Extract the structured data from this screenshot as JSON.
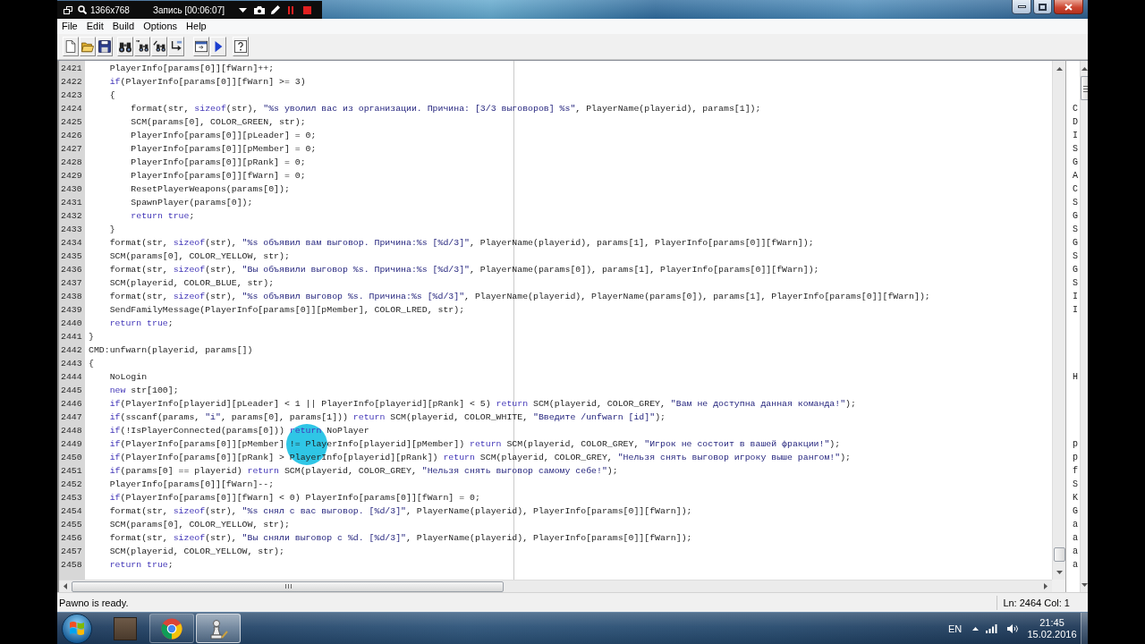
{
  "recorder": {
    "resolution": "1366x768",
    "status": "Запись [00:06:07]"
  },
  "menu": [
    "File",
    "Edit",
    "Build",
    "Options",
    "Help"
  ],
  "editor": {
    "lines": [
      {
        "number": "2421",
        "tokens": [
          {
            "kind": "plain",
            "text": "    PlayerInfo[params[0]][fWarn]++;"
          }
        ]
      },
      {
        "number": "2422",
        "tokens": [
          {
            "kind": "keyword",
            "text": "    if"
          },
          {
            "kind": "plain",
            "text": "(PlayerInfo[params[0]][fWarn] >= 3)"
          }
        ]
      },
      {
        "number": "2423",
        "tokens": [
          {
            "kind": "plain",
            "text": "    {"
          }
        ]
      },
      {
        "number": "2424",
        "tokens": [
          {
            "kind": "plain",
            "text": "        format(str, "
          },
          {
            "kind": "keyword",
            "text": "sizeof"
          },
          {
            "kind": "plain",
            "text": "(str), "
          },
          {
            "kind": "string",
            "text": "\"%s уволил вас из организации. Причина: [3/3 выговоров] %s\""
          },
          {
            "kind": "plain",
            "text": ", PlayerName(playerid), params[1]);"
          }
        ]
      },
      {
        "number": "2425",
        "tokens": [
          {
            "kind": "plain",
            "text": "        SCM(params[0], COLOR_GREEN, str);"
          }
        ]
      },
      {
        "number": "2426",
        "tokens": [
          {
            "kind": "plain",
            "text": "        PlayerInfo[params[0]][pLeader] = 0;"
          }
        ]
      },
      {
        "number": "2427",
        "tokens": [
          {
            "kind": "plain",
            "text": "        PlayerInfo[params[0]][pMember] = 0;"
          }
        ]
      },
      {
        "number": "2428",
        "tokens": [
          {
            "kind": "plain",
            "text": "        PlayerInfo[params[0]][pRank] = 0;"
          }
        ]
      },
      {
        "number": "2429",
        "tokens": [
          {
            "kind": "plain",
            "text": "        PlayerInfo[params[0]][fWarn] = 0;"
          }
        ]
      },
      {
        "number": "2430",
        "tokens": [
          {
            "kind": "plain",
            "text": "        ResetPlayerWeapons(params[0]);"
          }
        ]
      },
      {
        "number": "2431",
        "tokens": [
          {
            "kind": "plain",
            "text": "        SpawnPlayer(params[0]);"
          }
        ]
      },
      {
        "number": "2432",
        "tokens": [
          {
            "kind": "keyword",
            "text": "        return"
          },
          {
            "kind": "keyword",
            "text": " true"
          },
          {
            "kind": "plain",
            "text": ";"
          }
        ]
      },
      {
        "number": "2433",
        "tokens": [
          {
            "kind": "plain",
            "text": "    }"
          }
        ]
      },
      {
        "number": "2434",
        "tokens": [
          {
            "kind": "plain",
            "text": "    format(str, "
          },
          {
            "kind": "keyword",
            "text": "sizeof"
          },
          {
            "kind": "plain",
            "text": "(str), "
          },
          {
            "kind": "string",
            "text": "\"%s объявил вам выговор. Причина:%s [%d/3]\""
          },
          {
            "kind": "plain",
            "text": ", PlayerName(playerid), params[1], PlayerInfo[params[0]][fWarn]);"
          }
        ]
      },
      {
        "number": "2435",
        "tokens": [
          {
            "kind": "plain",
            "text": "    SCM(params[0], COLOR_YELLOW, str);"
          }
        ]
      },
      {
        "number": "2436",
        "tokens": [
          {
            "kind": "plain",
            "text": "    format(str, "
          },
          {
            "kind": "keyword",
            "text": "sizeof"
          },
          {
            "kind": "plain",
            "text": "(str), "
          },
          {
            "kind": "string",
            "text": "\"Вы объявили выговор %s. Причина:%s [%d/3]\""
          },
          {
            "kind": "plain",
            "text": ", PlayerName(params[0]), params[1], PlayerInfo[params[0]][fWarn]);"
          }
        ]
      },
      {
        "number": "2437",
        "tokens": [
          {
            "kind": "plain",
            "text": "    SCM(playerid, COLOR_BLUE, str);"
          }
        ]
      },
      {
        "number": "2438",
        "tokens": [
          {
            "kind": "plain",
            "text": "    format(str, "
          },
          {
            "kind": "keyword",
            "text": "sizeof"
          },
          {
            "kind": "plain",
            "text": "(str), "
          },
          {
            "kind": "string",
            "text": "\"%s объявил выговор %s. Причина:%s [%d/3]\""
          },
          {
            "kind": "plain",
            "text": ", PlayerName(playerid), PlayerName(params[0]), params[1], PlayerInfo[params[0]][fWarn]);"
          }
        ]
      },
      {
        "number": "2439",
        "tokens": [
          {
            "kind": "plain",
            "text": "    SendFamilyMessage(PlayerInfo[params[0]][pMember], COLOR_LRED, str);"
          }
        ]
      },
      {
        "number": "2440",
        "tokens": [
          {
            "kind": "keyword",
            "text": "    return"
          },
          {
            "kind": "keyword",
            "text": " true"
          },
          {
            "kind": "plain",
            "text": ";"
          }
        ]
      },
      {
        "number": "2441",
        "tokens": [
          {
            "kind": "plain",
            "text": "}"
          }
        ]
      },
      {
        "number": "2442",
        "tokens": [
          {
            "kind": "plain",
            "text": "CMD:unfwarn(playerid, params[])"
          }
        ]
      },
      {
        "number": "2443",
        "tokens": [
          {
            "kind": "plain",
            "text": "{"
          }
        ]
      },
      {
        "number": "2444",
        "tokens": [
          {
            "kind": "plain",
            "text": "    NoLogin"
          }
        ]
      },
      {
        "number": "2445",
        "tokens": [
          {
            "kind": "keyword",
            "text": "    new"
          },
          {
            "kind": "plain",
            "text": " str[100];"
          }
        ]
      },
      {
        "number": "2446",
        "tokens": [
          {
            "kind": "keyword",
            "text": "    if"
          },
          {
            "kind": "plain",
            "text": "(PlayerInfo[playerid][pLeader] < 1 || PlayerInfo[playerid][pRank] < 5) "
          },
          {
            "kind": "keyword",
            "text": "return"
          },
          {
            "kind": "plain",
            "text": " SCM(playerid, COLOR_GREY, "
          },
          {
            "kind": "string",
            "text": "\"Вам не доступна данная команда!\""
          },
          {
            "kind": "plain",
            "text": ");"
          }
        ]
      },
      {
        "number": "2447",
        "tokens": [
          {
            "kind": "keyword",
            "text": "    if"
          },
          {
            "kind": "plain",
            "text": "(sscanf(params, "
          },
          {
            "kind": "string",
            "text": "\"i\""
          },
          {
            "kind": "plain",
            "text": ", params[0], params[1])) "
          },
          {
            "kind": "keyword",
            "text": "return"
          },
          {
            "kind": "plain",
            "text": " SCM(playerid, COLOR_WHITE, "
          },
          {
            "kind": "string",
            "text": "\"Введите /unfwarn [id]\""
          },
          {
            "kind": "plain",
            "text": ");"
          }
        ]
      },
      {
        "number": "2448",
        "tokens": [
          {
            "kind": "keyword",
            "text": "    if"
          },
          {
            "kind": "plain",
            "text": "(!IsPlayerConnected(params[0])) "
          },
          {
            "kind": "keyword",
            "text": "return"
          },
          {
            "kind": "plain",
            "text": " NoPlayer"
          }
        ]
      },
      {
        "number": "2449",
        "tokens": [
          {
            "kind": "keyword",
            "text": "    if"
          },
          {
            "kind": "plain",
            "text": "(PlayerInfo[params[0]][pMember] != PlayerInfo[playerid][pMember]) "
          },
          {
            "kind": "keyword",
            "text": "return"
          },
          {
            "kind": "plain",
            "text": " SCM(playerid, COLOR_GREY, "
          },
          {
            "kind": "string",
            "text": "\"Игрок не состоит в вашей фракции!\""
          },
          {
            "kind": "plain",
            "text": ");"
          }
        ]
      },
      {
        "number": "2450",
        "tokens": [
          {
            "kind": "keyword",
            "text": "    if"
          },
          {
            "kind": "plain",
            "text": "(PlayerInfo[params[0]][pRank] > PlayerInfo[playerid][pRank]) "
          },
          {
            "kind": "keyword",
            "text": "return"
          },
          {
            "kind": "plain",
            "text": " SCM(playerid, COLOR_GREY, "
          },
          {
            "kind": "string",
            "text": "\"Нельзя снять выговор игроку выше рангом!\""
          },
          {
            "kind": "plain",
            "text": ");"
          }
        ]
      },
      {
        "number": "2451",
        "tokens": [
          {
            "kind": "keyword",
            "text": "    if"
          },
          {
            "kind": "plain",
            "text": "(params[0] == playerid) "
          },
          {
            "kind": "keyword",
            "text": "return"
          },
          {
            "kind": "plain",
            "text": " SCM(playerid, COLOR_GREY, "
          },
          {
            "kind": "string",
            "text": "\"Нельзя снять выговор самому себе!\""
          },
          {
            "kind": "plain",
            "text": ");"
          }
        ]
      },
      {
        "number": "2452",
        "tokens": [
          {
            "kind": "plain",
            "text": "    PlayerInfo[params[0]][fWarn]--;"
          }
        ]
      },
      {
        "number": "2453",
        "tokens": [
          {
            "kind": "keyword",
            "text": "    if"
          },
          {
            "kind": "plain",
            "text": "(PlayerInfo[params[0]][fWarn] < 0) PlayerInfo[params[0]][fWarn] = 0;"
          }
        ]
      },
      {
        "number": "2454",
        "tokens": [
          {
            "kind": "plain",
            "text": "    format(str, "
          },
          {
            "kind": "keyword",
            "text": "sizeof"
          },
          {
            "kind": "plain",
            "text": "(str), "
          },
          {
            "kind": "string",
            "text": "\"%s снял с вас выговор. [%d/3]\""
          },
          {
            "kind": "plain",
            "text": ", PlayerName(playerid), PlayerInfo[params[0]][fWarn]);"
          }
        ]
      },
      {
        "number": "2455",
        "tokens": [
          {
            "kind": "plain",
            "text": "    SCM(params[0], COLOR_YELLOW, str);"
          }
        ]
      },
      {
        "number": "2456",
        "tokens": [
          {
            "kind": "plain",
            "text": "    format(str, "
          },
          {
            "kind": "keyword",
            "text": "sizeof"
          },
          {
            "kind": "plain",
            "text": "(str), "
          },
          {
            "kind": "string",
            "text": "\"Вы сняли выговор с %d. [%d/3]\""
          },
          {
            "kind": "plain",
            "text": ", PlayerName(playerid), PlayerInfo[params[0]][fWarn]);"
          }
        ]
      },
      {
        "number": "2457",
        "tokens": [
          {
            "kind": "plain",
            "text": "    SCM(playerid, COLOR_YELLOW, str);"
          }
        ]
      },
      {
        "number": "2458",
        "tokens": [
          {
            "kind": "keyword",
            "text": "    return"
          },
          {
            "kind": "keyword",
            "text": " true"
          },
          {
            "kind": "plain",
            "text": ";"
          }
        ]
      }
    ]
  },
  "function_list": {
    "groups": [
      [
        "C",
        "D",
        "I",
        "S",
        "G",
        "A",
        "C",
        "S",
        "G",
        "S",
        "G",
        "S",
        "G",
        "S",
        "I",
        "I"
      ],
      [
        "H"
      ],
      [
        "p",
        "p",
        "f",
        "S",
        "K",
        "G",
        "a",
        "a",
        "a",
        "a"
      ]
    ]
  },
  "status_bar": {
    "message": "Pawno is ready.",
    "position": "Ln: 2464 Col: 1"
  },
  "taskbar": {
    "apps": [
      {
        "kind": "picture",
        "running": false,
        "selected": false
      },
      {
        "kind": "browser",
        "running": true,
        "selected": false
      },
      {
        "kind": "pawn",
        "running": true,
        "selected": true
      }
    ],
    "language": "EN",
    "time": "21:45",
    "date": "15.02.2016"
  }
}
